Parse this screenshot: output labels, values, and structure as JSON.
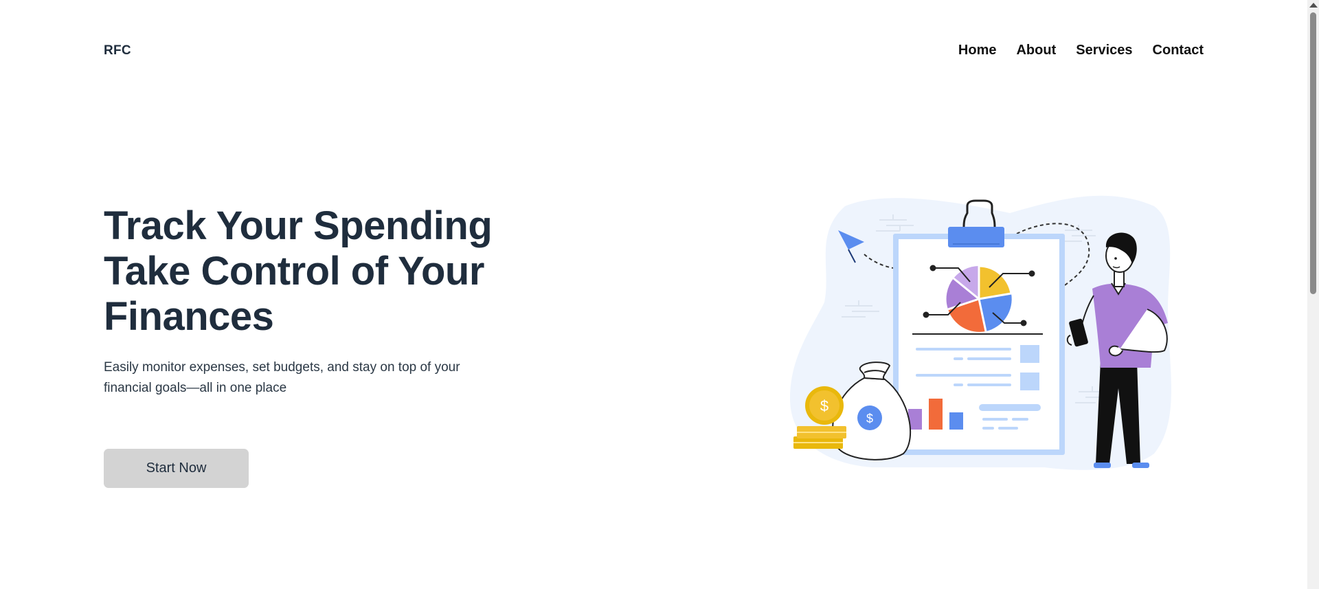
{
  "header": {
    "logo": "RFC",
    "nav": [
      "Home",
      "About",
      "Services",
      "Contact"
    ]
  },
  "hero": {
    "title_lines": [
      "Track Your Spending",
      "Take Control of Your",
      "Finances"
    ],
    "subtitle_lines": [
      "Easily monitor expenses, set budgets, and stay on top of your",
      "financial goals—all in one place"
    ],
    "cta_label": "Start Now"
  },
  "illustration": {
    "description_icon": "finance-clipboard-illustration",
    "coin_symbol": "$"
  },
  "colors": {
    "heading": "#1f2d3d",
    "button_bg": "#d3d3d3",
    "blob": "#eef4fd",
    "clipboard_blue": "#bcd6fb",
    "clip_blue": "#5b8def",
    "purple": "#a97fd6",
    "orange": "#f26b3a",
    "yellow": "#f2c12e",
    "gold": "#e9b80c"
  }
}
